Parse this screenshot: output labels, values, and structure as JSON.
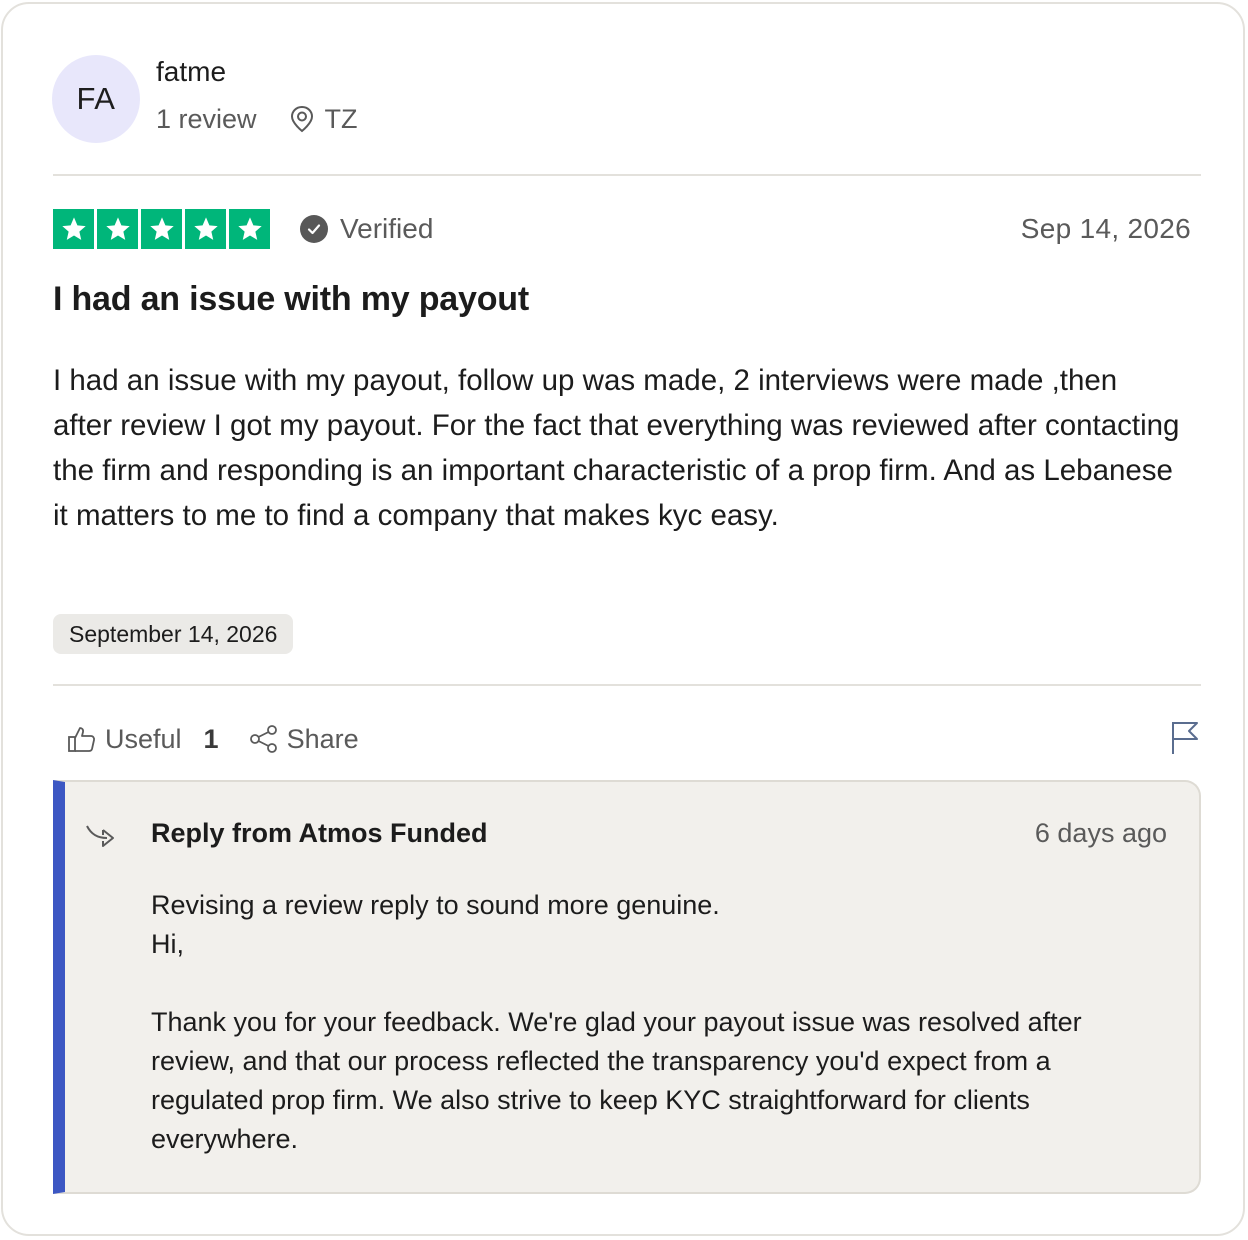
{
  "reviewer": {
    "initials": "FA",
    "name": "fatme",
    "review_count": "1 review",
    "location": "TZ",
    "location_icon": "map-pin-icon"
  },
  "review": {
    "rating": 5,
    "max_rating": 5,
    "star_color": "#00b67a",
    "verified_label": "Verified",
    "date_short": "Sep 14, 2026",
    "title": "I had an issue with my payout",
    "body": "I had an issue with my payout, follow up was made, 2 interviews were made ,then after review I got my payout. For the fact that everything was reviewed after contacting the firm and responding is an important characteristic of a prop firm. And as Lebanese it matters to me to find a company that makes kyc easy.",
    "date_long": "September 14, 2026"
  },
  "actions": {
    "useful_label": "Useful",
    "useful_count": "1",
    "share_label": "Share",
    "useful_icon": "thumbs-up-icon",
    "share_icon": "share-icon",
    "report_icon": "flag-icon"
  },
  "reply": {
    "title": "Reply from Atmos Funded",
    "date": "6 days ago",
    "text": "Revising a review reply to sound more genuine.\nHi,\n\nThank you for your feedback. We're glad your payout issue was resolved after review, and that our process reflected the transparency you'd expect from a regulated prop firm. We also strive to keep KYC straightforward for clients everywhere.",
    "accent_color": "#3c57c3",
    "icon": "reply-arrow-icon"
  }
}
